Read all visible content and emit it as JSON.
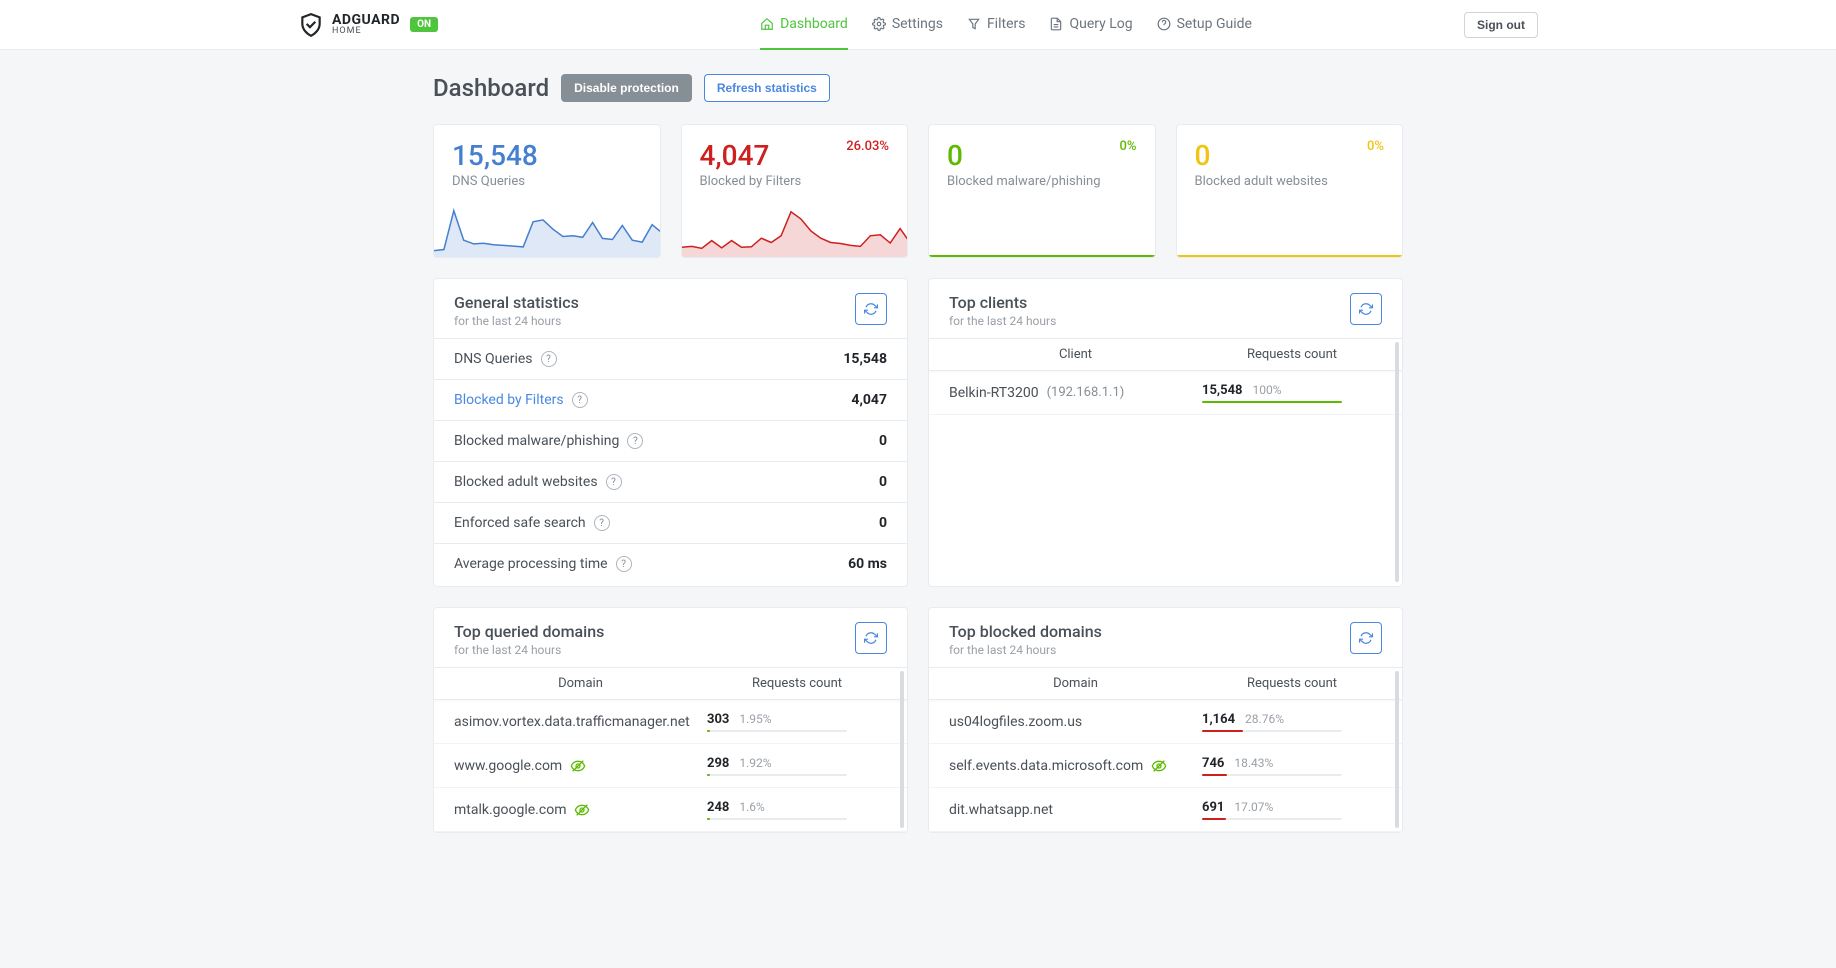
{
  "header": {
    "brand_main": "ADGUARD",
    "brand_sub": "HOME",
    "status_badge": "ON",
    "nav": [
      {
        "label": "Dashboard",
        "icon": "home-icon",
        "active": true
      },
      {
        "label": "Settings",
        "icon": "gear-icon",
        "active": false
      },
      {
        "label": "Filters",
        "icon": "filter-icon",
        "active": false
      },
      {
        "label": "Query Log",
        "icon": "file-icon",
        "active": false
      },
      {
        "label": "Setup Guide",
        "icon": "help-circle-icon",
        "active": false
      }
    ],
    "signout": "Sign out"
  },
  "page": {
    "title": "Dashboard",
    "disable_btn": "Disable protection",
    "refresh_btn": "Refresh statistics"
  },
  "stats_cards": [
    {
      "value": "15,548",
      "label": "DNS Queries",
      "color": "blue",
      "pct": ""
    },
    {
      "value": "4,047",
      "label": "Blocked by Filters",
      "color": "red",
      "pct": "26.03%"
    },
    {
      "value": "0",
      "label": "Blocked malware/phishing",
      "color": "green",
      "pct": "0%"
    },
    {
      "value": "0",
      "label": "Blocked adult websites",
      "color": "yellow",
      "pct": "0%"
    }
  ],
  "general": {
    "title": "General statistics",
    "subtitle": "for the last 24 hours",
    "rows": [
      {
        "label": "DNS Queries",
        "value": "15,548",
        "link": false
      },
      {
        "label": "Blocked by Filters",
        "value": "4,047",
        "link": true
      },
      {
        "label": "Blocked malware/phishing",
        "value": "0",
        "link": false
      },
      {
        "label": "Blocked adult websites",
        "value": "0",
        "link": false
      },
      {
        "label": "Enforced safe search",
        "value": "0",
        "link": false
      },
      {
        "label": "Average processing time",
        "value": "60 ms",
        "link": false
      }
    ]
  },
  "top_clients": {
    "title": "Top clients",
    "subtitle": "for the last 24 hours",
    "col1": "Client",
    "col2": "Requests count",
    "rows": [
      {
        "name": "Belkin-RT3200",
        "ip": "(192.168.1.1)",
        "count": "15,548",
        "pct": "100%",
        "bar": 100,
        "bar_color": "green"
      }
    ]
  },
  "top_queried": {
    "title": "Top queried domains",
    "subtitle": "for the last 24 hours",
    "col1": "Domain",
    "col2": "Requests count",
    "rows": [
      {
        "domain": "asimov.vortex.data.trafficmanager.net",
        "tracker": false,
        "count": "303",
        "pct": "1.95%",
        "bar": 2,
        "bar_color": "green"
      },
      {
        "domain": "www.google.com",
        "tracker": true,
        "count": "298",
        "pct": "1.92%",
        "bar": 2,
        "bar_color": "green"
      },
      {
        "domain": "mtalk.google.com",
        "tracker": true,
        "count": "248",
        "pct": "1.6%",
        "bar": 2,
        "bar_color": "green"
      }
    ]
  },
  "top_blocked": {
    "title": "Top blocked domains",
    "subtitle": "for the last 24 hours",
    "col1": "Domain",
    "col2": "Requests count",
    "rows": [
      {
        "domain": "us04logfiles.zoom.us",
        "tracker": false,
        "count": "1,164",
        "pct": "28.76%",
        "bar": 29,
        "bar_color": "red"
      },
      {
        "domain": "self.events.data.microsoft.com",
        "tracker": true,
        "count": "746",
        "pct": "18.43%",
        "bar": 18,
        "bar_color": "red"
      },
      {
        "domain": "dit.whatsapp.net",
        "tracker": false,
        "count": "691",
        "pct": "17.07%",
        "bar": 17,
        "bar_color": "red"
      }
    ]
  },
  "chart_data": [
    {
      "type": "area",
      "title": "DNS Queries sparkline",
      "x": [
        0,
        1,
        2,
        3,
        4,
        5,
        6,
        7,
        8,
        9,
        10,
        11,
        12,
        13,
        14,
        15,
        16,
        17,
        18,
        19,
        20,
        21,
        22,
        23
      ],
      "values": [
        120,
        150,
        1200,
        400,
        300,
        320,
        280,
        260,
        240,
        220,
        900,
        950,
        700,
        500,
        520,
        480,
        880,
        450,
        420,
        800,
        400,
        350,
        820,
        600
      ],
      "ylim": [
        0,
        1300
      ],
      "color": "#467fcf"
    },
    {
      "type": "area",
      "title": "Blocked by Filters sparkline",
      "x": [
        0,
        1,
        2,
        3,
        4,
        5,
        6,
        7,
        8,
        9,
        10,
        11,
        12,
        13,
        14,
        15,
        16,
        17,
        18,
        19,
        20,
        21,
        22,
        23
      ],
      "values": [
        160,
        180,
        140,
        300,
        150,
        300,
        160,
        170,
        350,
        260,
        400,
        900,
        750,
        500,
        350,
        260,
        240,
        200,
        180,
        400,
        420,
        250,
        550,
        260
      ],
      "ylim": [
        0,
        1000
      ],
      "color": "#cd201f"
    }
  ]
}
